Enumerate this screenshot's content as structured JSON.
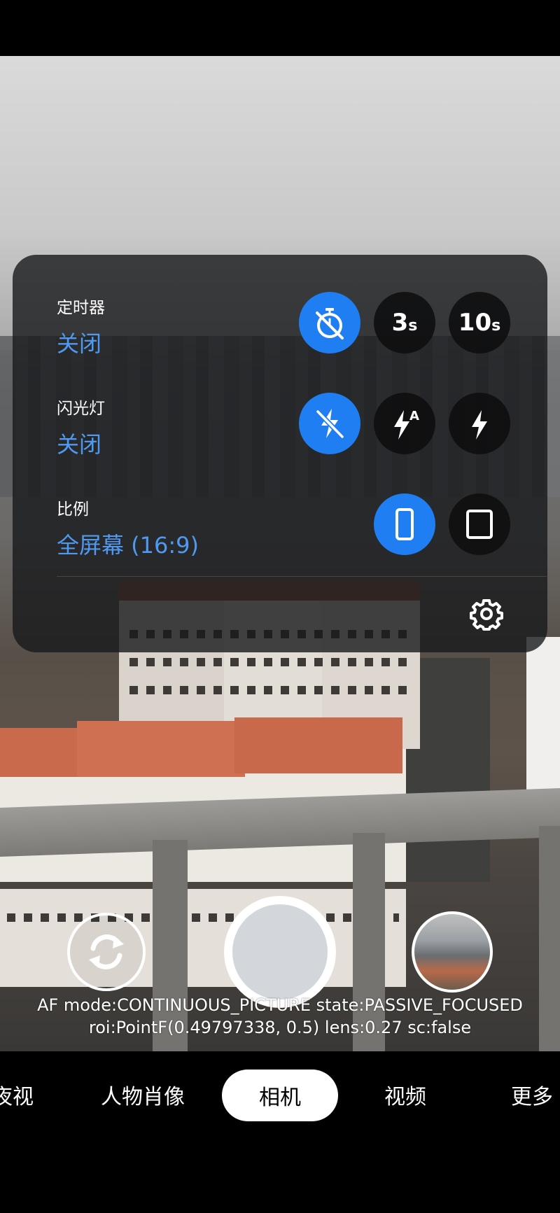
{
  "settings": {
    "timer": {
      "title": "定时器",
      "value": "关闭",
      "options": [
        {
          "name": "off",
          "icon": "timer-off-icon",
          "active": true
        },
        {
          "name": "3s",
          "big": "3",
          "small": "s",
          "active": false
        },
        {
          "name": "10s",
          "big": "10",
          "small": "s",
          "active": false
        }
      ]
    },
    "flash": {
      "title": "闪光灯",
      "value": "关闭",
      "options": [
        {
          "name": "off",
          "icon": "flash-off-icon",
          "active": true
        },
        {
          "name": "auto",
          "icon": "flash-auto-icon",
          "badge": "A",
          "active": false
        },
        {
          "name": "on",
          "icon": "flash-on-icon",
          "active": false
        }
      ]
    },
    "ratio": {
      "title": "比例",
      "value": "全屏幕 (16:9)",
      "options": [
        {
          "name": "16:9",
          "icon": "ratio-tall-icon",
          "active": true
        },
        {
          "name": "4:3",
          "icon": "ratio-square-icon",
          "active": false
        }
      ]
    },
    "accent_color": "#1f7ff2",
    "value_color": "#4f9af0"
  },
  "debug": {
    "line1": "AF mode:CONTINUOUS_PICTURE state:PASSIVE_FOCUSED",
    "line2": "roi:PointF(0.49797338, 0.5) lens:0.27 sc:false"
  },
  "modes": {
    "items": [
      "夜视",
      "人物肖像",
      "相机",
      "视频",
      "更多"
    ],
    "visible_partial_first": "夜视",
    "active": "相机"
  }
}
